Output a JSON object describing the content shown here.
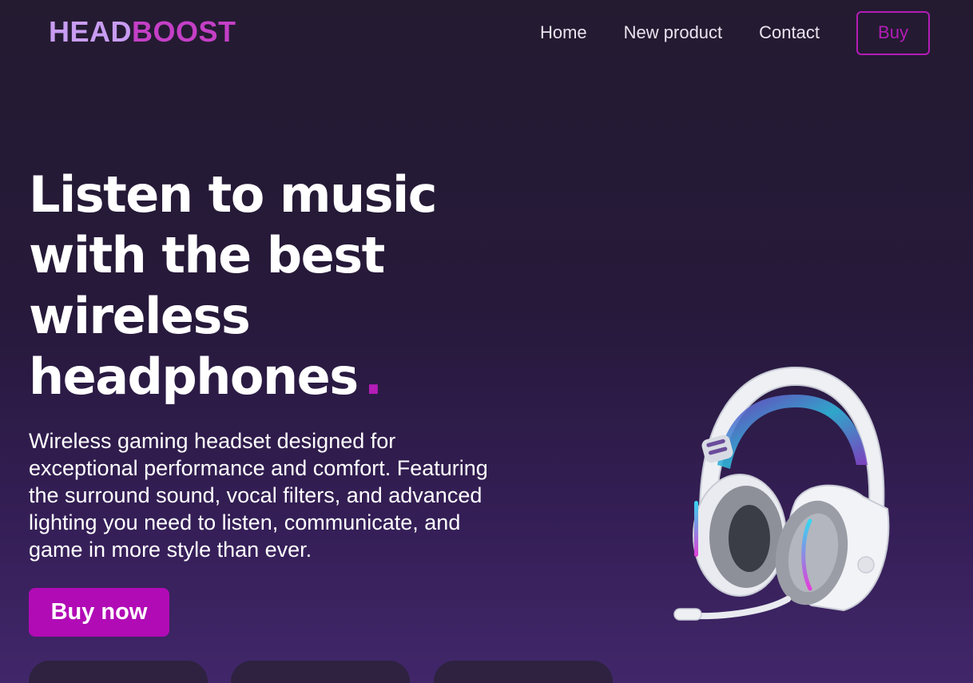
{
  "brand": {
    "name_part1": "HEAD",
    "name_part2": "BOOST",
    "color_part1": "#c89cf2",
    "color_part2": "#c43fc6"
  },
  "nav": {
    "links": [
      "Home",
      "New product",
      "Contact"
    ],
    "buy_label": "Buy"
  },
  "hero": {
    "title_lines": [
      "Listen to music",
      "with the best",
      "wireless",
      "headphones"
    ],
    "title_dot": ".",
    "description_lines": [
      "Wireless gaming headset designed for",
      "exceptional performance and comfort. Featuring",
      "the surround sound, vocal filters, and advanced",
      "lighting you need to listen, communicate, and",
      "game in more style than ever."
    ],
    "cta_label": "Buy now",
    "product_icon": "headset-image"
  },
  "colors": {
    "accent": "#b10bb5",
    "background_top": "#241b31",
    "background_bottom": "#41276a"
  }
}
